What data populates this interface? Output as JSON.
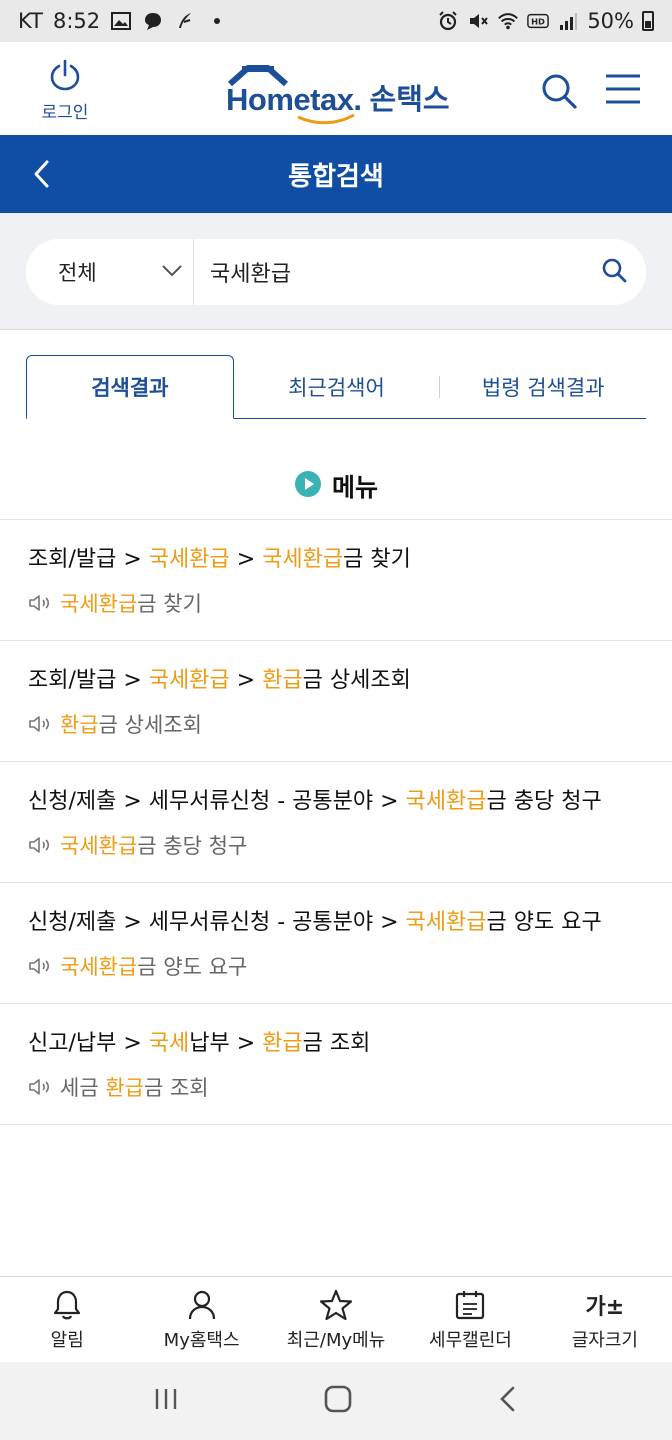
{
  "status_bar": {
    "carrier": "KT",
    "time": "8:52",
    "battery": "50%",
    "battery_level": 0.5,
    "left_icons": [
      "image-icon",
      "chat-bubble-icon",
      "feather-icon",
      "dot-icon"
    ],
    "right_icons": [
      "alarm-icon",
      "mute-icon",
      "wifi-icon",
      "hd-icon",
      "signal-icon",
      "battery-icon"
    ]
  },
  "header": {
    "login_label": "로그인",
    "logo_en": "Hometax.",
    "logo_kr": "손택스",
    "brand_color": "#1d4f98"
  },
  "title_bar": {
    "title": "통합검색",
    "background": "#0f4ea4"
  },
  "search": {
    "scope": "전체",
    "query": "국세환급"
  },
  "tabs": [
    {
      "label": "검색결과",
      "active": true
    },
    {
      "label": "최근검색어",
      "active": false
    },
    {
      "label": "법령 검색결과",
      "active": false
    }
  ],
  "section": {
    "title": "메뉴"
  },
  "results": [
    {
      "path": [
        {
          "t": "조회/발급 > "
        },
        {
          "t": "국세환급",
          "hl": true
        },
        {
          "t": " > "
        },
        {
          "t": "국세환급",
          "hl": true
        },
        {
          "t": "금 찾기"
        }
      ],
      "sub": [
        {
          "t": "국세환급",
          "hl": true
        },
        {
          "t": "금 찾기"
        }
      ]
    },
    {
      "path": [
        {
          "t": "조회/발급 > "
        },
        {
          "t": "국세환급",
          "hl": true
        },
        {
          "t": " > "
        },
        {
          "t": "환급",
          "hl": true
        },
        {
          "t": "금 상세조회"
        }
      ],
      "sub": [
        {
          "t": "환급",
          "hl": true
        },
        {
          "t": "금 상세조회"
        }
      ]
    },
    {
      "path": [
        {
          "t": "신청/제출 > 세무서류신청 - 공통분야 > "
        },
        {
          "t": "국세환급",
          "hl": true
        },
        {
          "t": "금 충당 청구"
        }
      ],
      "sub": [
        {
          "t": "국세환급",
          "hl": true
        },
        {
          "t": "금 충당 청구"
        }
      ]
    },
    {
      "path": [
        {
          "t": "신청/제출 > 세무서류신청 - 공통분야 > "
        },
        {
          "t": "국세환급",
          "hl": true
        },
        {
          "t": "금 양도 요구"
        }
      ],
      "sub": [
        {
          "t": "국세환급",
          "hl": true
        },
        {
          "t": "금 양도 요구"
        }
      ]
    },
    {
      "path": [
        {
          "t": "신고/납부 > "
        },
        {
          "t": "국세",
          "hl": true
        },
        {
          "t": "납부 > "
        },
        {
          "t": "환급",
          "hl": true
        },
        {
          "t": "금 조회"
        }
      ],
      "sub": [
        {
          "t": "세금 "
        },
        {
          "t": "환급",
          "hl": true
        },
        {
          "t": "금 조회"
        }
      ]
    }
  ],
  "highlight_color": "#ef9b13",
  "bottom_nav": [
    {
      "label": "알림",
      "icon": "bell-icon"
    },
    {
      "label": "My홈택스",
      "icon": "person-icon"
    },
    {
      "label": "최근/My메뉴",
      "icon": "star-icon"
    },
    {
      "label": "세무캘린더",
      "icon": "calendar-icon"
    },
    {
      "label": "글자크기",
      "icon": "font-size-icon",
      "glyph": "가±"
    }
  ],
  "system_nav": [
    "recent-apps-icon",
    "home-icon",
    "back-icon"
  ]
}
